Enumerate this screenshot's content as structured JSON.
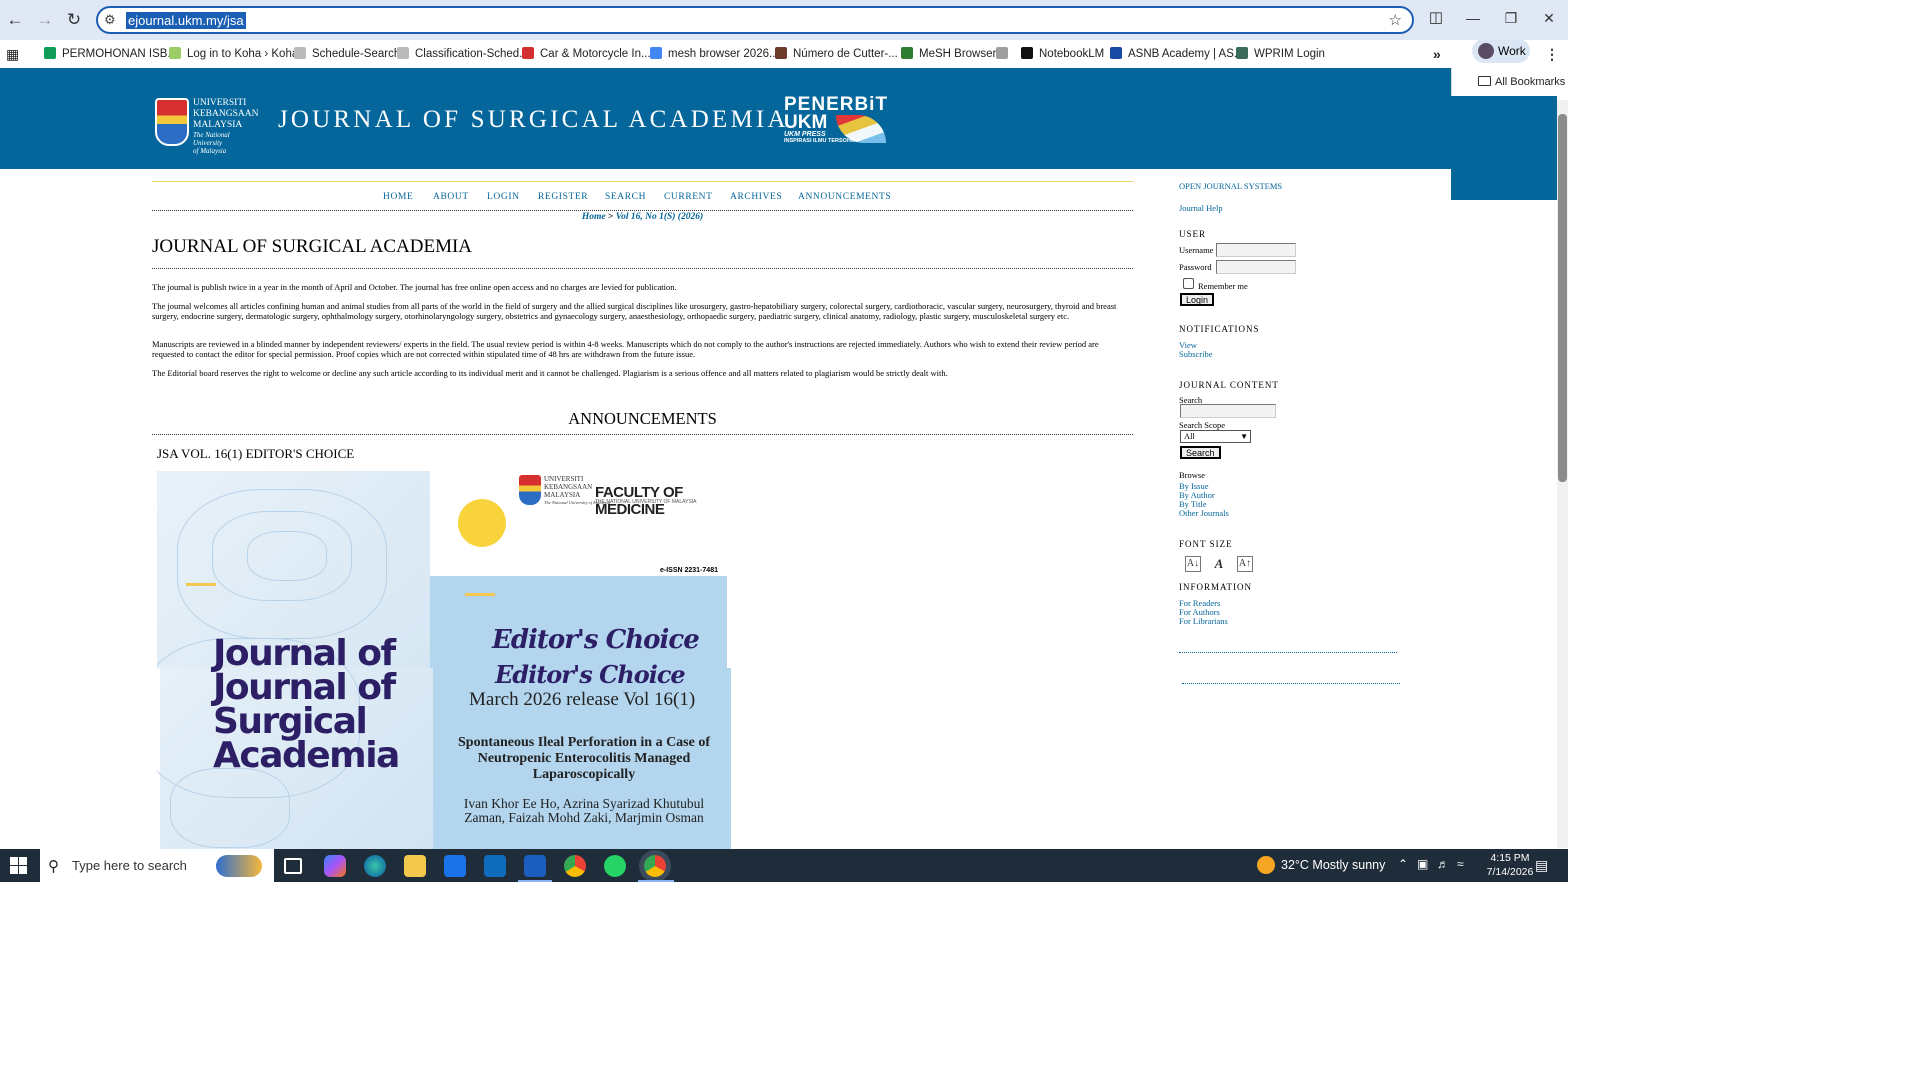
{
  "browser": {
    "url": "ejournal.ukm.my/jsa",
    "bookmarks": [
      "PERMOHONAN ISB...",
      "Log in to Koha › Koha",
      "Schedule-Search",
      "Classification-Sched...",
      "Car & Motorcycle In...",
      "mesh browser 2026...",
      "Número de Cutter-...",
      "MeSH Browser",
      "NotebookLM",
      "ASNB Academy | AS...",
      "WPRIM Login"
    ],
    "profile_label": "Work",
    "all_bookmarks_label": "All Bookmarks",
    "bookmark_colors": [
      "#0f9d58",
      "#9ccc65",
      "#bbbbbb",
      "#bbbbbb",
      "#d32f2f",
      "#4285f4",
      "#6d3b2a",
      "#2e7d32",
      "#9e9e9e",
      "#111111",
      "#1a49a3",
      "#3a6b5a"
    ]
  },
  "header": {
    "ukm_logo_lines": [
      "UNIVERSITI",
      "KEBANGSAAN",
      "MALAYSIA"
    ],
    "ukm_logo_sub": [
      "The National University",
      "of Malaysia"
    ],
    "banner_title": "JOURNAL OF SURGICAL ACADEMIA",
    "penerbit_lines": [
      "PENERBiT",
      "UKM",
      "UKM PRESS",
      "INSPIRASI ILMU TERSOHOR"
    ]
  },
  "nav": {
    "items": [
      "HOME",
      "ABOUT",
      "LOGIN",
      "REGISTER",
      "SEARCH",
      "CURRENT",
      "ARCHIVES",
      "ANNOUNCEMENTS"
    ]
  },
  "breadcrumb": {
    "home": "Home",
    "separator": " > ",
    "current": "Vol 16, No 1(S) (2026)"
  },
  "main": {
    "title": "JOURNAL OF SURGICAL ACADEMIA",
    "paragraphs": [
      "The journal is publish twice in a year in the month of April and October. The journal has free online open access and no charges are levied for publication.",
      "The journal welcomes all articles confining human and animal studies from all parts of the world in the field of surgery and the allied surgical disciplines like urosurgery, gastro-hepatobiliary surgery, colorectal surgery, cardiothoracic, vascular surgery, neurosurgery, thyroid and breast surgery, endocrine surgery, dermatologic surgery, ophthalmology surgery, otorhinolaryngology surgery, obstetrics and gynaecology surgery, anaesthesiology, orthopaedic surgery, paediatric surgery, clinical anatomy, radiology, plastic surgery, musculoskeletal surgery etc.",
      "Manuscripts are reviewed in a blinded manner by independent reviewers/ experts in the field. The usual review period is within 4-8 weeks. Manuscripts which do not comply to the author's instructions are rejected immediately. Authors who wish to extend their review period are requested to contact the editor for special permission. Proof copies which are not corrected within stipulated time of 48 hrs are withdrawn from the future issue.",
      "The Editorial board reserves the right to welcome or decline any such article according to its individual merit and it cannot be challenged. Plagiarism is a serious offence and all matters related to plagiarism would be strictly dealt with."
    ],
    "announcements_heading": "ANNOUNCEMENTS",
    "announcement_title": "JSA VOL. 16(1) EDITOR'S CHOICE"
  },
  "poster": {
    "fom_logo_lines": [
      "UNIVERSITI",
      "KEBANGSAAN",
      "MALAYSIA"
    ],
    "fom_logo_sub": "The National University of Malaysia",
    "faculty": "FACULTY OF MEDICINE",
    "faculty_sub": "THE NATIONAL UNIVERSITY OF MALAYSIA",
    "issn": "e-ISSN 2231-7481",
    "journal_lines": [
      "Journal of",
      "Journal of",
      "Surgical",
      "Academia"
    ],
    "editors_choice": "Editor's Choice",
    "release": "March 2026 release Vol 16(1)",
    "article_title": "Spontaneous Ileal Perforation in a Case of Neutropenic Enterocolitis Managed Laparoscopically",
    "authors": "Ivan Khor Ee Ho, Azrina Syarizad Khutubul Zaman, Faizah Mohd Zaki, Marjmin Osman"
  },
  "sidebar": {
    "ojs": "OPEN JOURNAL SYSTEMS",
    "journal_help": "Journal Help",
    "user_heading": "USER",
    "username_label": "Username",
    "password_label": "Password",
    "remember_label": "Remember me",
    "login_btn": "Login",
    "notifications_heading": "NOTIFICATIONS",
    "notif_view": "View",
    "notif_subscribe": "Subscribe",
    "content_heading": "JOURNAL CONTENT",
    "search_label": "Search",
    "scope_label": "Search Scope",
    "scope_value": "All",
    "search_btn": "Search",
    "browse_label": "Browse",
    "browse_links": [
      "By Issue",
      "By Author",
      "By Title",
      "Other Journals"
    ],
    "font_heading": "FONT SIZE",
    "info_heading": "INFORMATION",
    "info_links": [
      "For Readers",
      "For Authors",
      "For Librarians"
    ]
  },
  "taskbar": {
    "search_placeholder": "Type here to search",
    "weather": "32°C  Mostly sunny",
    "time": "4:15 PM",
    "date": "7/14/2026"
  }
}
